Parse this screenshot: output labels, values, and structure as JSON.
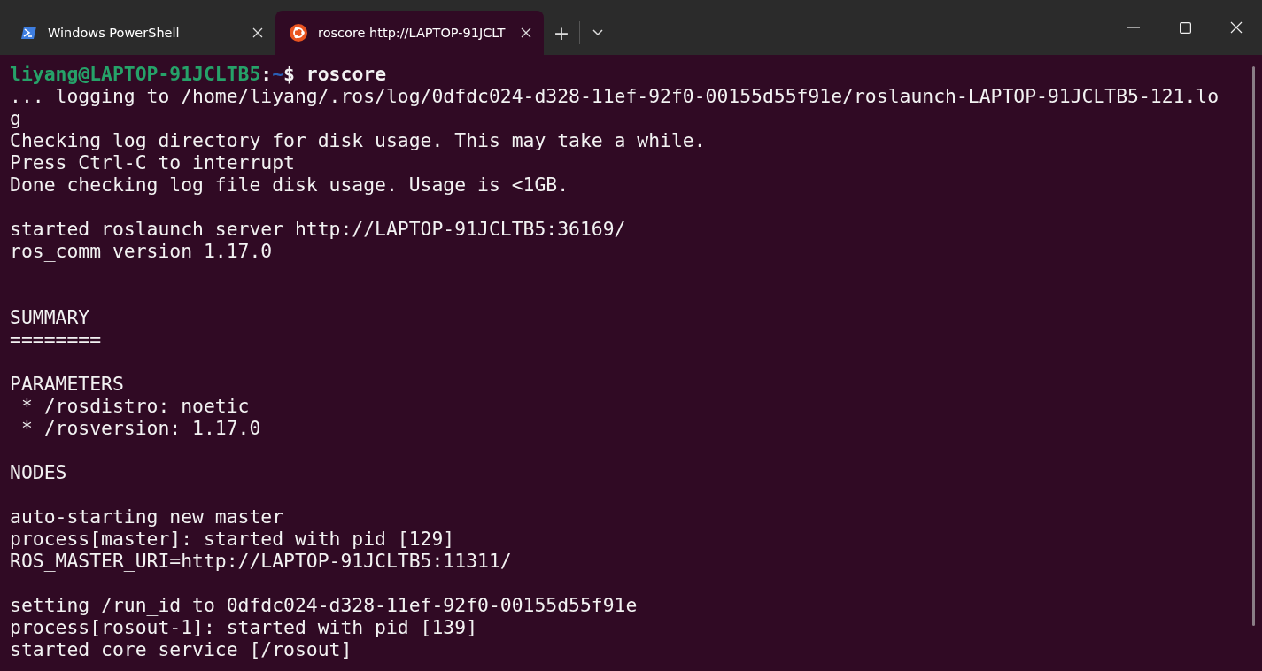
{
  "tabs": [
    {
      "title": "Windows PowerShell",
      "kind": "powershell",
      "selected": false
    },
    {
      "title": "roscore http://LAPTOP-91JCLT",
      "kind": "ubuntu",
      "selected": true
    }
  ],
  "new_tab": "+",
  "terminal": {
    "lines": [
      {
        "kind": "prompt",
        "user": "liyang@LAPTOP-91JCLTB5",
        "sep": ":",
        "path": "~",
        "command": "$ roscore"
      },
      {
        "kind": "output",
        "text": "... logging to /home/liyang/.ros/log/0dfdc024-d328-11ef-92f0-00155d55f91e/roslaunch-LAPTOP-91JCLTB5-121.lo"
      },
      {
        "kind": "output",
        "text": "g"
      },
      {
        "kind": "output",
        "text": "Checking log directory for disk usage. This may take a while."
      },
      {
        "kind": "output",
        "text": "Press Ctrl-C to interrupt"
      },
      {
        "kind": "output",
        "text": "Done checking log file disk usage. Usage is <1GB."
      },
      {
        "kind": "blank"
      },
      {
        "kind": "output",
        "text": "started roslaunch server http://LAPTOP-91JCLTB5:36169/"
      },
      {
        "kind": "output",
        "text": "ros_comm version 1.17.0"
      },
      {
        "kind": "blank"
      },
      {
        "kind": "blank"
      },
      {
        "kind": "output",
        "text": "SUMMARY"
      },
      {
        "kind": "output",
        "text": "========"
      },
      {
        "kind": "blank"
      },
      {
        "kind": "output",
        "text": "PARAMETERS"
      },
      {
        "kind": "output",
        "text": " * /rosdistro: noetic"
      },
      {
        "kind": "output",
        "text": " * /rosversion: 1.17.0"
      },
      {
        "kind": "blank"
      },
      {
        "kind": "output",
        "text": "NODES"
      },
      {
        "kind": "blank"
      },
      {
        "kind": "output",
        "text": "auto-starting new master"
      },
      {
        "kind": "output",
        "text": "process[master]: started with pid [129]"
      },
      {
        "kind": "output",
        "text": "ROS_MASTER_URI=http://LAPTOP-91JCLTB5:11311/"
      },
      {
        "kind": "blank"
      },
      {
        "kind": "output",
        "text": "setting /run_id to 0dfdc024-d328-11ef-92f0-00155d55f91e"
      },
      {
        "kind": "output",
        "text": "process[rosout-1]: started with pid [139]"
      },
      {
        "kind": "output",
        "text": "started core service [/rosout]"
      }
    ]
  }
}
